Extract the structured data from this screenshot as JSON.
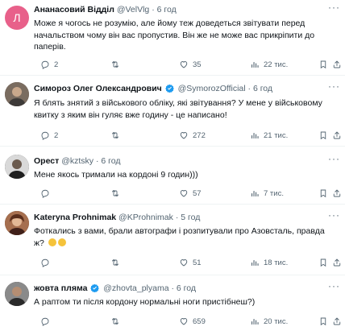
{
  "tweets": [
    {
      "name": "Ананасовий Відділ",
      "handle": "@VelVlg",
      "time": "· 6 год",
      "verified": false,
      "avatar_letter": "Л",
      "avatar_color": "#e8608a",
      "text": "Може я чогось не розумію, але йому теж доведеться звітувати перед начальством чому він вас пропустив. Він же не може вас прикріпити до паперів.",
      "replies": "2",
      "retweets": "",
      "likes": "35",
      "views": "22 тис."
    },
    {
      "name": "Симороз Олег Олександрович",
      "handle": "@SymorozOfficial",
      "time": "· 6 год",
      "verified": true,
      "text": "Я блять знятий з військового обліку, які звітування? У мене у військовому квитку з яким він гуляє вже годину - це написано!",
      "replies": "2",
      "retweets": "",
      "likes": "272",
      "views": "21 тис."
    },
    {
      "name": "Орест",
      "handle": "@kztsky",
      "time": "· 6 год",
      "verified": false,
      "text": "Мене якось тримали на кордоні 9 годин)))",
      "replies": "",
      "retweets": "",
      "likes": "57",
      "views": "7 тис."
    },
    {
      "name": "Kateryna Prohnimak",
      "handle": "@KProhnimak",
      "time": "· 5 год",
      "verified": false,
      "text": "Фоткались з вами, брали автографи і розпитували про Азовсталь, правда ж?",
      "replies": "",
      "retweets": "",
      "likes": "51",
      "views": "18 тис."
    },
    {
      "name": "жовта пляма",
      "handle": "@zhovta_plyama",
      "time": "· 6 год",
      "verified": true,
      "text": "А раптом ти після кордону нормальні ноги пристібнеш?)",
      "replies": "",
      "retweets": "",
      "likes": "659",
      "views": "20 тис."
    }
  ],
  "colors": {
    "text": "#0f1419",
    "secondary": "#536471",
    "verified": "#1d9bf0",
    "divider": "#eff3f4"
  },
  "icons": [
    "reply-icon",
    "retweet-icon",
    "like-icon",
    "views-icon",
    "bookmark-icon",
    "share-icon",
    "more-icon",
    "verified-badge-icon"
  ]
}
